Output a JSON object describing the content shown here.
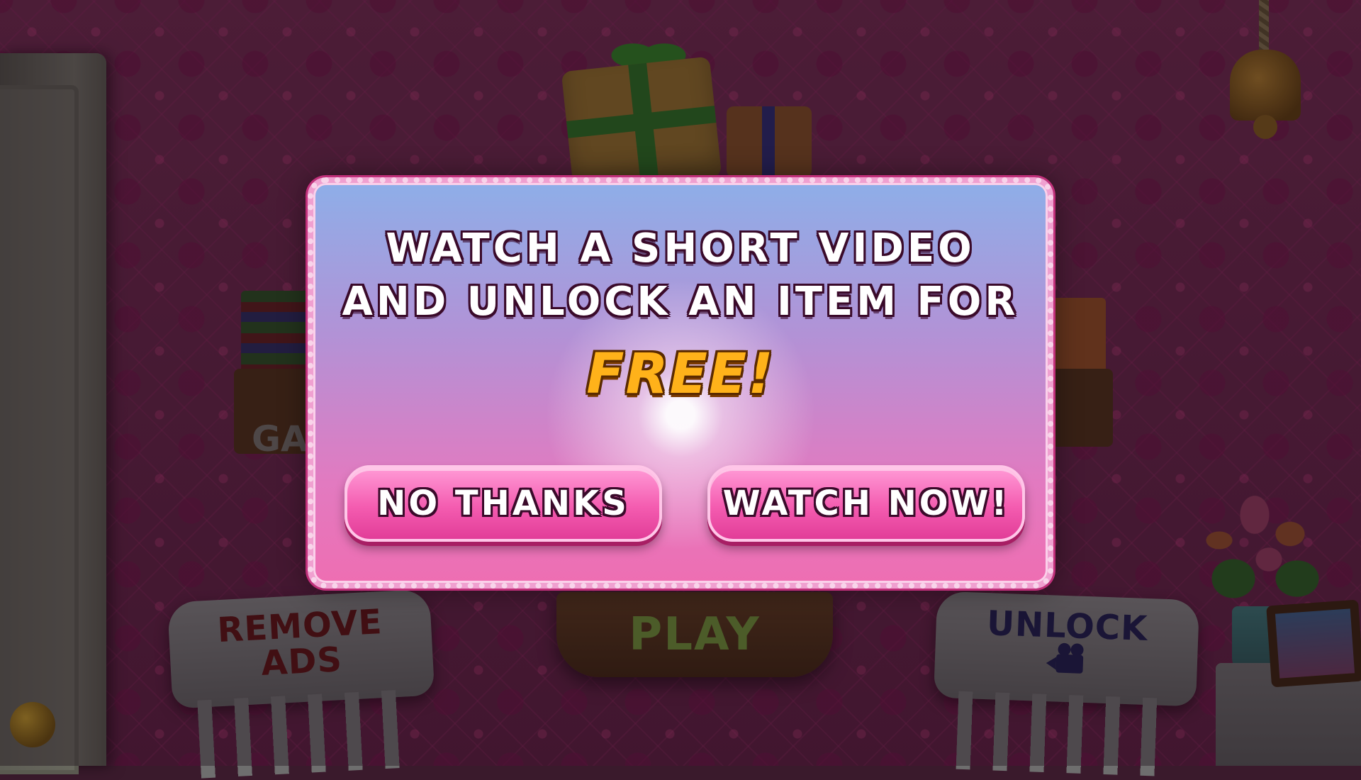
{
  "modal": {
    "line1": "WATCH A SHORT VIDEO",
    "line2": "AND UNLOCK AN ITEM FOR",
    "free": "FREE!",
    "no_thanks_label": "NO THANKS",
    "watch_now_label": "WATCH NOW!"
  },
  "background": {
    "play_label": "PLAY",
    "remove_ads_line1": "REMOVE",
    "remove_ads_line2": "ADS",
    "unlock_label": "UNLOCK",
    "unlock_icon": "movie-camera-icon",
    "left_shelf_label_partial": "GA"
  },
  "colors": {
    "free_text": "#ffb21a",
    "button_pink": "#f45cb0",
    "modal_top": "#8eaee8",
    "modal_bottom": "#ee6eb2"
  }
}
